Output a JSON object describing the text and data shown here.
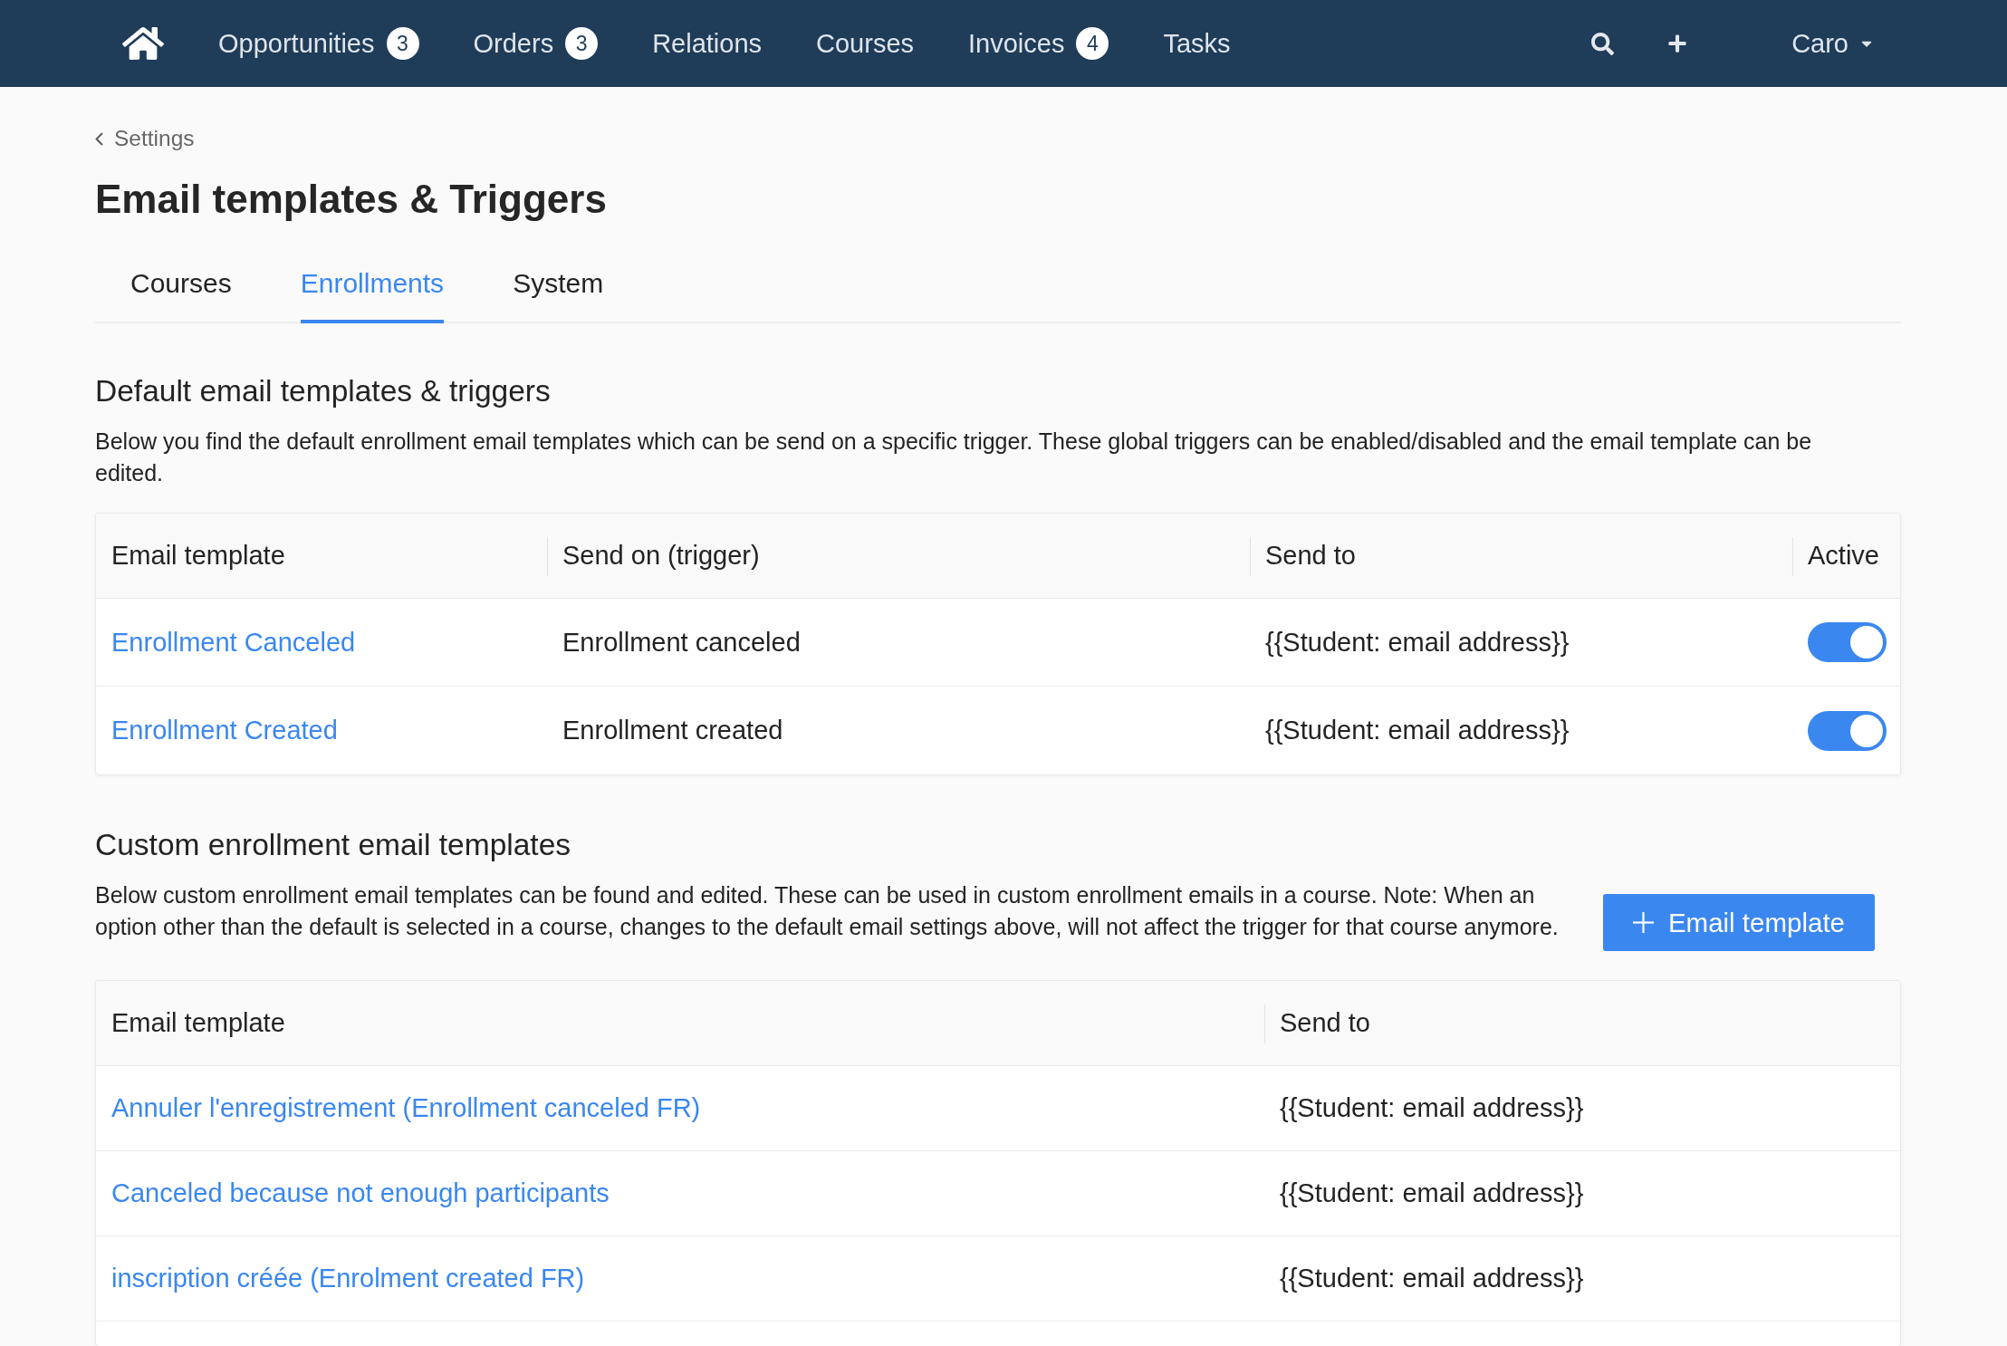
{
  "nav": {
    "items": [
      {
        "label": "Opportunities",
        "badge": "3"
      },
      {
        "label": "Orders",
        "badge": "3"
      },
      {
        "label": "Relations"
      },
      {
        "label": "Courses"
      },
      {
        "label": "Invoices",
        "badge": "4"
      },
      {
        "label": "Tasks"
      }
    ],
    "user": "Caro"
  },
  "breadcrumb": "Settings",
  "title": "Email templates & Triggers",
  "tabs": [
    {
      "label": "Courses",
      "selected": false
    },
    {
      "label": "Enrollments",
      "selected": true
    },
    {
      "label": "System",
      "selected": false
    }
  ],
  "default_templates": {
    "heading": "Default email templates & triggers",
    "description": "Below you find the default enrollment email templates which can be send on a specific trigger. These global triggers can be enabled/disabled and the email template can be edited.",
    "table": {
      "columns": [
        "Email template",
        "Send on (trigger)",
        "Send to",
        "Active"
      ],
      "rows": [
        {
          "template": "Enrollment Canceled",
          "trigger": "Enrollment canceled",
          "send_to": "{{Student: email address}}",
          "active": true
        },
        {
          "template": "Enrollment Created",
          "trigger": "Enrollment created",
          "send_to": "{{Student: email address}}",
          "active": true
        }
      ]
    }
  },
  "custom_templates": {
    "heading": "Custom enrollment email templates",
    "description": "Below custom enrollment email templates can be found and edited. These can be used in custom enrollment emails in a course. Note: When an option other than the default is selected in a course, changes to the default email settings above, will not affect the trigger for that course anymore.",
    "add_button": "Email template",
    "table": {
      "columns": [
        "Email template",
        "Send to"
      ],
      "rows": [
        {
          "template": "Annuler l'enregistrement (Enrollment canceled FR)",
          "send_to": "{{Student: email address}}"
        },
        {
          "template": "Canceled because not enough participants",
          "send_to": "{{Student: email address}}"
        },
        {
          "template": "inscription créée (Enrolment created FR)",
          "send_to": "{{Student: email address}}"
        }
      ]
    }
  }
}
